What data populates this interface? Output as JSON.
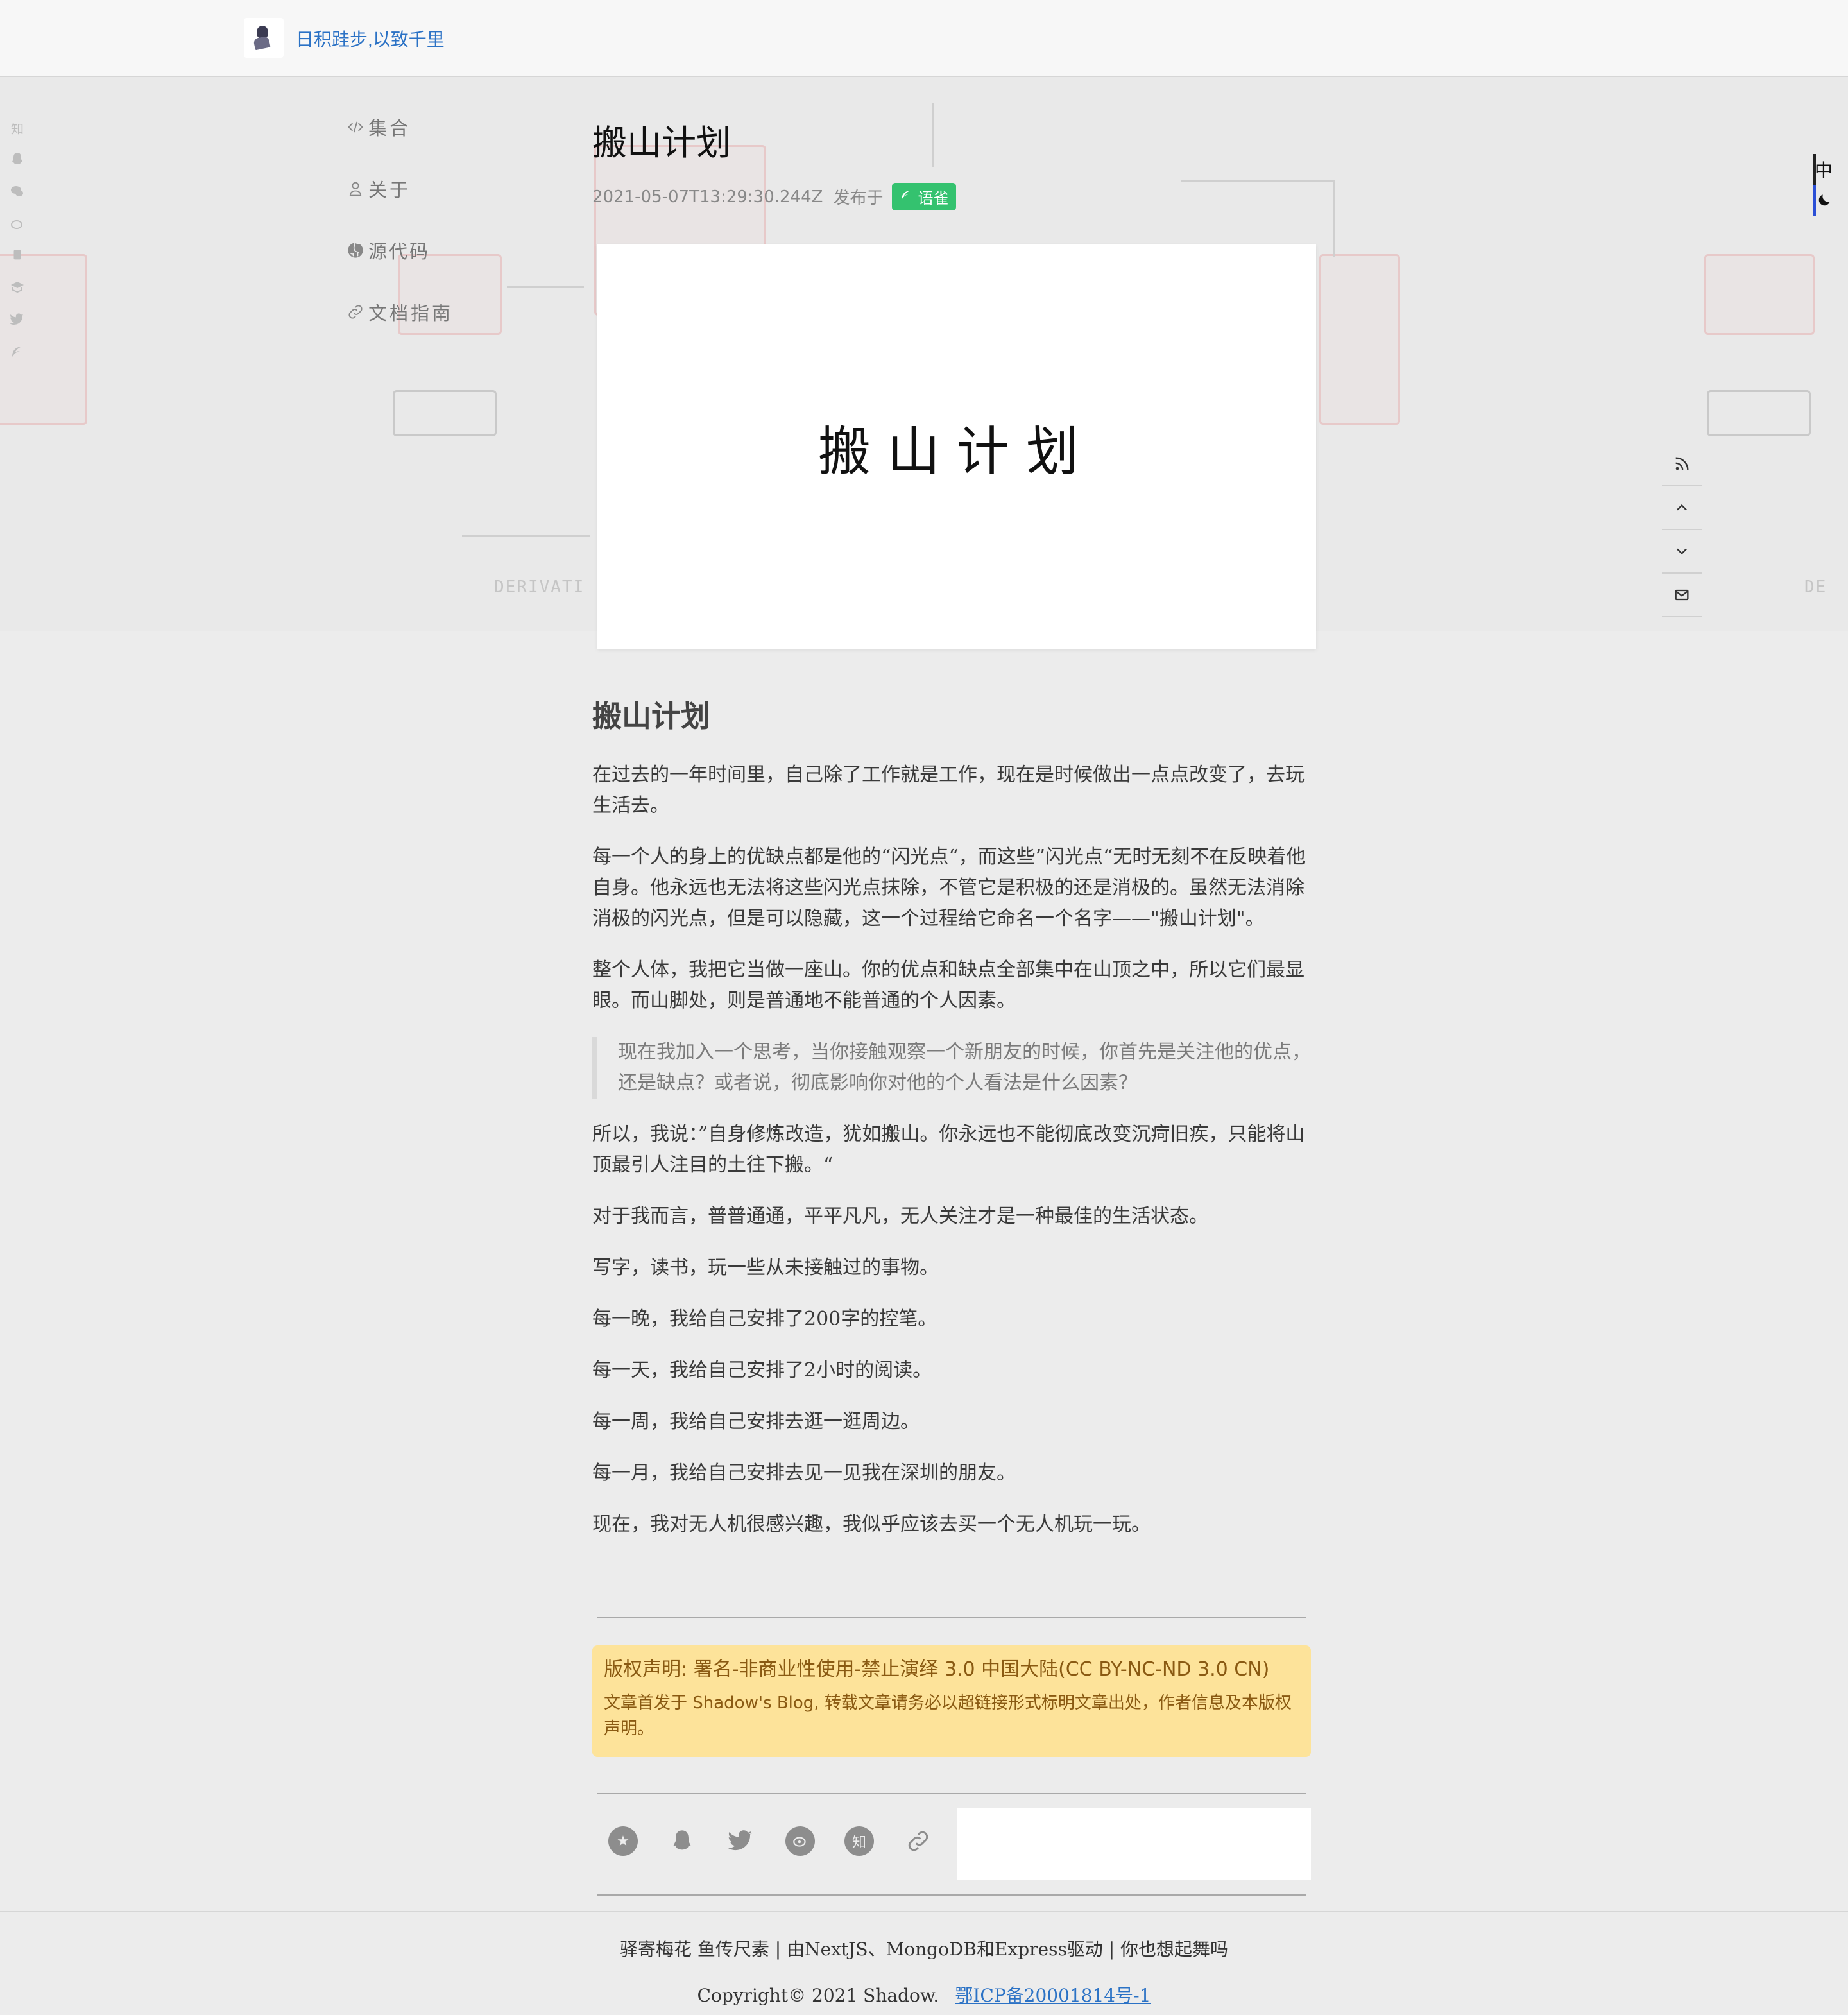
{
  "header": {
    "site_title": "日积跬步,以致千里"
  },
  "nav": {
    "items": [
      {
        "icon": "code-icon",
        "label": "集合"
      },
      {
        "icon": "user-icon",
        "label": "关于"
      },
      {
        "icon": "github-icon",
        "label": "源代码"
      },
      {
        "icon": "link-icon",
        "label": "文档指南"
      }
    ]
  },
  "left_social": [
    "知",
    "qq-icon",
    "wechat-icon",
    "weibo-icon",
    "rss-icon",
    "book-icon",
    "twitter-icon",
    "feather-icon"
  ],
  "post": {
    "title": "搬山计划",
    "date": "2021-05-07T13:29:30.244Z",
    "published_in": "发布于",
    "tag": "语雀",
    "cover_text": "搬山计划",
    "heading": "搬山计划",
    "paragraphs": [
      "在过去的一年时间里，自己除了工作就是工作，现在是时候做出一点点改变了，去玩生活去。",
      "每一个人的身上的优缺点都是他的“闪光点“，而这些”闪光点“无时无刻不在反映着他自身。他永远也无法将这些闪光点抹除，不管它是积极的还是消极的。虽然无法消除消极的闪光点，但是可以隐藏，这一个过程给它命名一个名字——\"搬山计划\"。",
      "整个人体，我把它当做一座山。你的优点和缺点全部集中在山顶之中，所以它们最显眼。而山脚处，则是普通地不能普通的个人因素。"
    ],
    "quote": "现在我加入一个思考，当你接触观察一个新朋友的时候，你首先是关注他的优点，还是缺点？或者说，彻底影响你对他的个人看法是什么因素？",
    "paragraphs_after": [
      "所以，我说：”自身修炼改造，犹如搬山。你永远也不能彻底改变沉疴旧疾，只能将山顶最引人注目的土往下搬。“",
      "对于我而言，普普通通，平平凡凡，无人关注才是一种最佳的生活状态。",
      "写字，读书，玩一些从未接触过的事物。",
      "每一晚，我给自己安排了200字的控笔。",
      "每一天，我给自己安排了2小时的阅读。",
      "每一周，我给自己安排去逛一逛周边。",
      "每一月，我给自己安排去见一见我在深圳的朋友。",
      "现在，我对无人机很感兴趣，我似乎应该去买一个无人机玩一玩。"
    ]
  },
  "license": {
    "title": "版权声明: 署名-非商业性使用-禁止演绎 3.0 中国大陆(CC BY-NC-ND 3.0 CN)",
    "body": "文章首发于 Shadow's Blog, 转载文章请务必以超链接形式标明文章出处，作者信息及本版权声明。"
  },
  "share": {
    "icons": [
      "qzone-icon",
      "qq-icon",
      "twitter-icon",
      "weibo-icon",
      "zhihu-icon",
      "link-icon"
    ],
    "zhihu_glyph": "知"
  },
  "footer": {
    "line1": "驿寄梅花 鱼传尺素 | 由NextJS、MongoDB和Express驱动 | 你也想起舞吗",
    "copyright": "Copyright© 2021 Shadow.",
    "icp": "鄂ICP备20001814号-1"
  },
  "side": {
    "lang": "中"
  },
  "colors": {
    "accent": "#2b72c5",
    "tag": "#34c26f",
    "license_bg": "#fde39a",
    "license_text": "#8a5a12"
  }
}
